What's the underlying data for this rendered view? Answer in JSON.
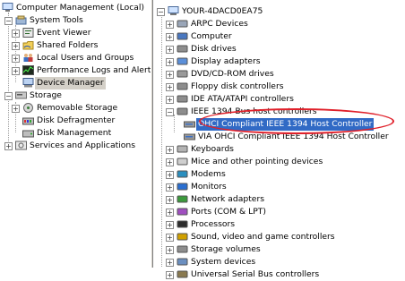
{
  "left_tree": {
    "root": "Computer Management (Local)",
    "system_tools": "System Tools",
    "event_viewer": "Event Viewer",
    "shared_folders": "Shared Folders",
    "local_users": "Local Users and Groups",
    "perf_logs": "Performance Logs and Alerts",
    "device_manager": "Device Manager",
    "storage": "Storage",
    "removable_storage": "Removable Storage",
    "disk_defrag": "Disk Defragmenter",
    "disk_mgmt": "Disk Management",
    "services_apps": "Services and Applications"
  },
  "right_tree": {
    "root": "YOUR-4DACD0EA75",
    "categories": [
      "ARPC Devices",
      "Computer",
      "Disk drives",
      "Display adapters",
      "DVD/CD-ROM drives",
      "Floppy disk controllers",
      "IDE ATA/ATAPI controllers",
      "IEEE 1394 Bus host controllers",
      "Keyboards",
      "Mice and other pointing devices",
      "Modems",
      "Monitors",
      "Network adapters",
      "Ports (COM & LPT)",
      "Processors",
      "Sound, video and game controllers",
      "Storage volumes",
      "System devices",
      "Universal Serial Bus controllers"
    ],
    "ieee_children": [
      "OHCI Compliant IEEE 1394 Host Controller",
      "VIA OHCI Compliant IEEE 1394 Host Controller"
    ]
  },
  "colors": {
    "selection": "#316ac5",
    "highlight_ring": "#e0202a"
  }
}
